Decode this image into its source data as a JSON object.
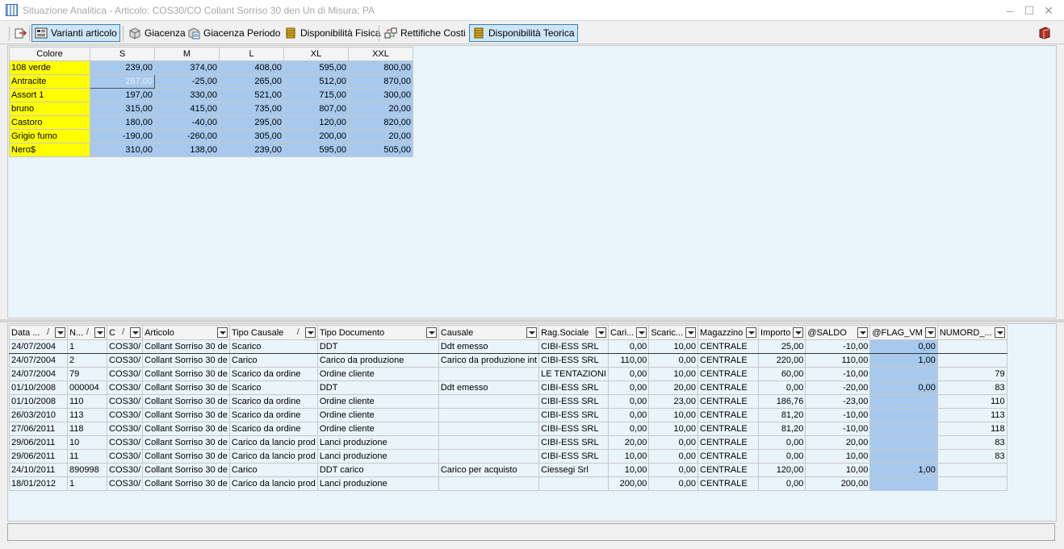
{
  "window": {
    "title": "Situazione Analitica - Articolo: COS30/CO  Collant Sorriso 30 den Un di Misura: PA"
  },
  "toolbar": {
    "buttons": [
      {
        "label": "Varianti articolo",
        "icon": "variants-icon"
      },
      {
        "label": "Giacenza",
        "icon": "box-icon"
      },
      {
        "label": "Giacenza Periodo",
        "icon": "calendar-icon"
      },
      {
        "label": "Disponibilità Fisica",
        "icon": "stack-icon"
      },
      {
        "label": "Rettifiche Costi",
        "icon": "adjust-icon"
      },
      {
        "label": "Disponibilità Teorica",
        "icon": "stack-icon"
      }
    ],
    "help_icon": "book-icon"
  },
  "pivot": {
    "headers": [
      "Colore",
      "S",
      "M",
      "L",
      "XL",
      "XXL"
    ],
    "rows": [
      [
        "108 verde",
        "239,00",
        "374,00",
        "408,00",
        "595,00",
        "800,00"
      ],
      [
        "Antracite",
        "267,00",
        "-25,00",
        "265,00",
        "512,00",
        "870,00"
      ],
      [
        "Assort 1",
        "197,00",
        "330,00",
        "521,00",
        "715,00",
        "300,00"
      ],
      [
        "bruno",
        "315,00",
        "415,00",
        "735,00",
        "807,00",
        "20,00"
      ],
      [
        "Castoro",
        "180,00",
        "-40,00",
        "295,00",
        "120,00",
        "820,00"
      ],
      [
        "Grigio fumo",
        "-190,00",
        "-260,00",
        "305,00",
        "200,00",
        "20,00"
      ],
      [
        "Nero$",
        "310,00",
        "138,00",
        "239,00",
        "595,00",
        "505,00"
      ]
    ]
  },
  "grid": {
    "headers": [
      "Data ...",
      "N...",
      "C",
      "Articolo",
      "Tipo Causale",
      "Tipo Documento",
      "Causale",
      "Rag.Sociale",
      "Cari...",
      "Scaric...",
      "Magazzino",
      "Importo",
      "@SALDO",
      "@FLAG_VM",
      "NUMORD_..."
    ],
    "rows": [
      [
        "24/07/2004",
        "1",
        "COS30/",
        "Collant Sorriso 30 de",
        "Scarico",
        "DDT",
        "Ddt emesso",
        "CIBI-ESS SRL",
        "0,00",
        "10,00",
        "CENTRALE",
        "25,00",
        "-10,00",
        "0,00",
        ""
      ],
      [
        "24/07/2004",
        "2",
        "COS30/",
        "Collant Sorriso 30 de",
        "Carico",
        "Carico da produzione",
        "Carico da produzione int",
        "CIBI-ESS SRL",
        "110,00",
        "0,00",
        "CENTRALE",
        "220,00",
        "110,00",
        "1,00",
        ""
      ],
      [
        "24/07/2004",
        "79",
        "COS30/",
        "Collant Sorriso 30 de",
        "Scarico da ordine",
        "Ordine cliente",
        "",
        "LE TENTAZIONI",
        "0,00",
        "10,00",
        "CENTRALE",
        "60,00",
        "-10,00",
        "",
        "79"
      ],
      [
        "01/10/2008",
        "000004",
        "COS30/",
        "Collant Sorriso 30 de",
        "Scarico",
        "DDT",
        "Ddt emesso",
        "CIBI-ESS SRL",
        "0,00",
        "20,00",
        "CENTRALE",
        "0,00",
        "-20,00",
        "0,00",
        "83"
      ],
      [
        "01/10/2008",
        "110",
        "COS30/",
        "Collant Sorriso 30 de",
        "Scarico da ordine",
        "Ordine cliente",
        "",
        "CIBI-ESS SRL",
        "0,00",
        "23,00",
        "CENTRALE",
        "186,76",
        "-23,00",
        "",
        "110"
      ],
      [
        "26/03/2010",
        "113",
        "COS30/",
        "Collant Sorriso 30 de",
        "Scarico da ordine",
        "Ordine cliente",
        "",
        "CIBI-ESS SRL",
        "0,00",
        "10,00",
        "CENTRALE",
        "81,20",
        "-10,00",
        "",
        "113"
      ],
      [
        "27/06/2011",
        "118",
        "COS30/",
        "Collant Sorriso 30 de",
        "Scarico da ordine",
        "Ordine cliente",
        "",
        "CIBI-ESS SRL",
        "0,00",
        "10,00",
        "CENTRALE",
        "81,20",
        "-10,00",
        "",
        "118"
      ],
      [
        "29/06/2011",
        "10",
        "COS30/",
        "Collant Sorriso 30 de",
        "Carico da lancio prod",
        "Lanci produzione",
        "",
        "CIBI-ESS SRL",
        "20,00",
        "0,00",
        "CENTRALE",
        "0,00",
        "20,00",
        "",
        "83"
      ],
      [
        "29/06/2011",
        "11",
        "COS30/",
        "Collant Sorriso 30 de",
        "Carico da lancio prod",
        "Lanci produzione",
        "",
        "CIBI-ESS SRL",
        "10,00",
        "0,00",
        "CENTRALE",
        "0,00",
        "10,00",
        "",
        "83"
      ],
      [
        "24/10/2011",
        "890998",
        "COS30/",
        "Collant Sorriso 30 de",
        "Carico",
        "DDT carico",
        "Carico per acquisto",
        "Ciessegi Srl",
        "10,00",
        "0,00",
        "CENTRALE",
        "120,00",
        "10,00",
        "1,00",
        ""
      ],
      [
        "18/01/2012",
        "1",
        "COS30/",
        "Collant Sorriso 30 de",
        "Carico da lancio prod",
        "Lanci produzione",
        "",
        "",
        "200,00",
        "0,00",
        "CENTRALE",
        "0,00",
        "200,00",
        "",
        ""
      ]
    ]
  },
  "colors": {
    "accent": "#cde6f7",
    "pivot_value": "#a7c9ee",
    "pivot_label": "#ffff00",
    "panel_bg": "#eaf4fb"
  }
}
